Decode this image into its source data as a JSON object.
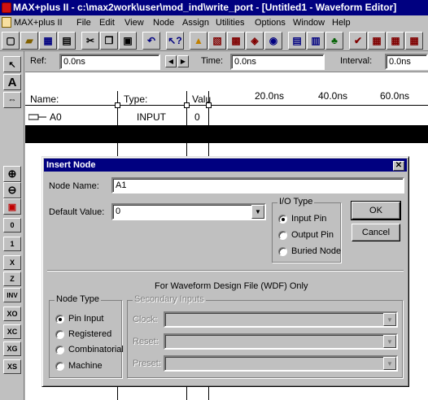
{
  "window": {
    "title": "MAX+plus II - c:\\max2work\\user\\mod_ind\\write_port - [Untitled1 - Waveform Editor]"
  },
  "menu": {
    "items": [
      "MAX+plus II",
      "File",
      "Edit",
      "View",
      "Node",
      "Assign",
      "Utilities",
      "Options",
      "Window",
      "Help"
    ]
  },
  "refbar": {
    "ref_label": "Ref:",
    "ref_value": "0.0ns",
    "time_label": "Time:",
    "time_value": "0.0ns",
    "interval_label": "Interval:",
    "interval_value": "0.0ns"
  },
  "header": {
    "name": "Name:",
    "type": "Type:",
    "value": "Valu",
    "t1": "20.0ns",
    "t2": "40.0ns",
    "t3": "60.0ns"
  },
  "nodes": [
    {
      "name": "A0",
      "type": "INPUT",
      "value": "0"
    }
  ],
  "leftbar": {
    "tools": [
      "↖",
      "A",
      "⇔"
    ],
    "zoom": [
      "⊕",
      "⊖",
      "▣"
    ],
    "levels": [
      "0",
      "1",
      "X",
      "Z",
      "INV",
      "XO",
      "XC",
      "XG",
      "XS"
    ]
  },
  "dialog": {
    "title": "Insert Node",
    "node_name_label": "Node Name:",
    "node_name_value": "A1",
    "default_value_label": "Default Value:",
    "default_value_selected": "0",
    "io_type": {
      "title": "I/O Type",
      "options": [
        "Input Pin",
        "Output Pin",
        "Buried Node"
      ],
      "selected": 0
    },
    "ok_label": "OK",
    "cancel_label": "Cancel",
    "wdf_note": "For Waveform Design File (WDF) Only",
    "node_type": {
      "title": "Node Type",
      "options": [
        "Pin Input",
        "Registered",
        "Combinatorial",
        "Machine"
      ],
      "selected": 0
    },
    "secondary": {
      "title": "Secondary Inputs",
      "clock_label": "Clock:",
      "reset_label": "Reset:",
      "preset_label": "Preset:"
    }
  }
}
